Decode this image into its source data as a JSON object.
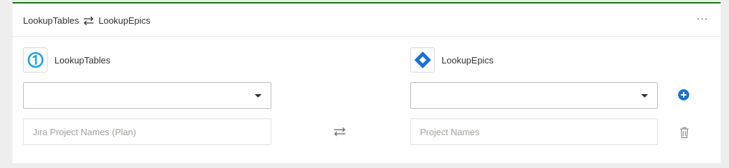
{
  "header": {
    "source_name": "LookupTables",
    "swap_icon": "swap-arrows-icon",
    "target_name": "LookupEpics",
    "more_label": "···",
    "accent_color": "#107c10"
  },
  "source": {
    "app_name": "LookupTables",
    "logo_icon": "onetable-logo-icon",
    "dropdown_value": "",
    "field_placeholder": "Jira Project Names (Plan)",
    "field_value": ""
  },
  "target": {
    "app_name": "LookupEpics",
    "logo_icon": "jira-logo-icon",
    "dropdown_value": "",
    "field_placeholder": "Project Names",
    "field_value": ""
  },
  "actions": {
    "add_icon": "plus-circle-icon",
    "delete_icon": "trash-icon",
    "mapping_icon": "swap-arrows-icon",
    "add_color": "#1a73c9"
  }
}
